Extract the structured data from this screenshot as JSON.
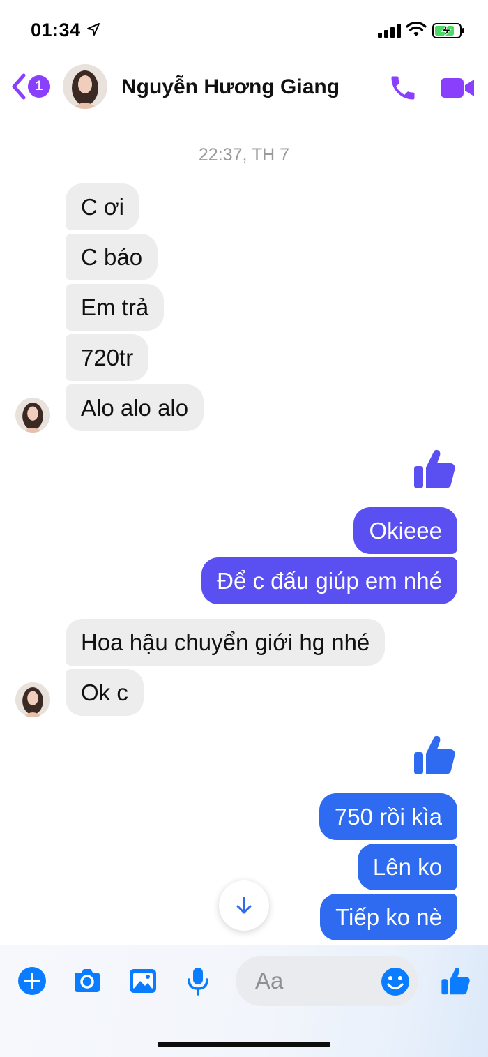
{
  "status_bar": {
    "time": "01:34"
  },
  "header": {
    "back_badge": "1",
    "contact_name": "Nguyễn Hương Giang"
  },
  "conversation": {
    "timestamp": "22:37, TH 7",
    "group1_incoming": [
      "C ơi",
      "C báo",
      "Em trả",
      "720tr",
      "Alo alo alo"
    ],
    "group2_outgoing": [
      "Okieee",
      "Để c đấu giúp em nhé"
    ],
    "group3_incoming": [
      "Hoa hậu chuyển giới hg nhé",
      "Ok c"
    ],
    "group4_outgoing": [
      "750 rồi kìa",
      "Lên ko",
      "Tiếp ko nè"
    ]
  },
  "composer": {
    "placeholder": "Aa"
  },
  "colors": {
    "accent_purple": "#8a3ffc",
    "outgoing_indigo": "#5a4ff0",
    "outgoing_blue": "#2e6bf0",
    "composer_blue": "#0a7cff",
    "incoming_gray": "#ededed"
  }
}
